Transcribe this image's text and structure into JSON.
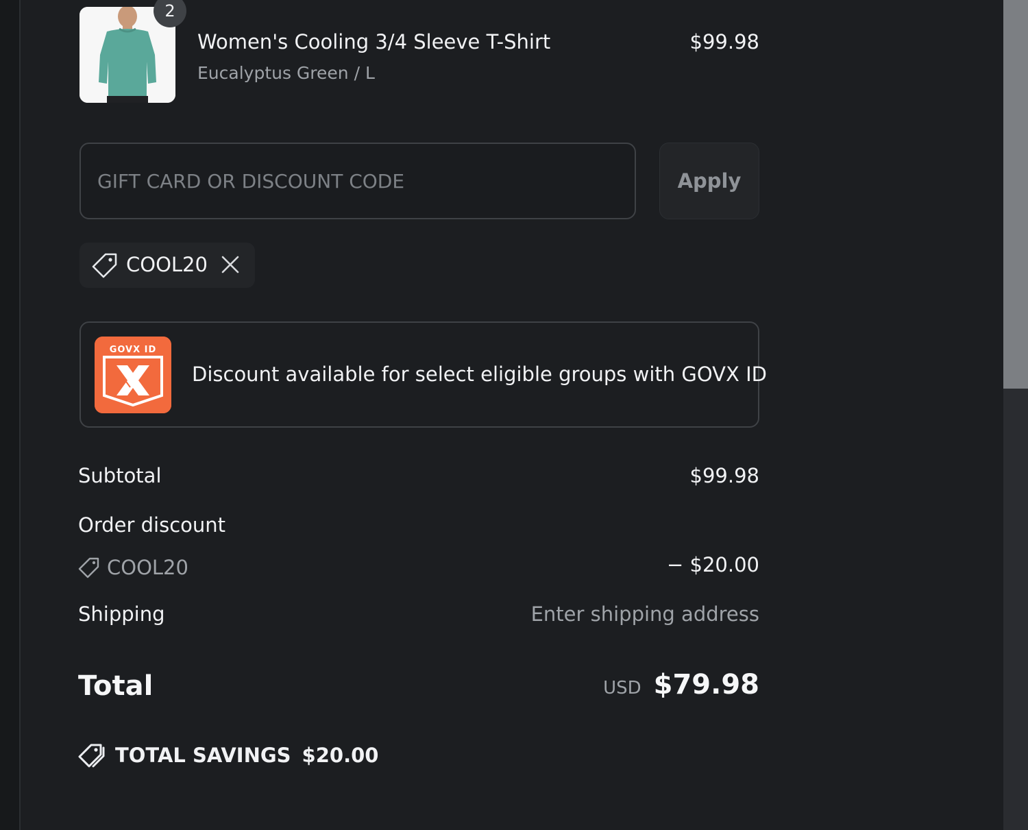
{
  "product": {
    "title": "Women's Cooling 3/4 Sleeve T-Shirt",
    "variant": "Eucalyptus Green / L",
    "price": "$99.98",
    "quantity": "2",
    "image_icon": "shirt-thumbnail"
  },
  "discount_form": {
    "placeholder": "GIFT CARD OR DISCOUNT CODE",
    "value": "",
    "apply_label": "Apply"
  },
  "applied_code": {
    "code": "COOL20",
    "tag_icon": "tag-icon",
    "remove_icon": "close-icon"
  },
  "govx_banner": {
    "logo_text": "GOVX ID",
    "text": "Discount available for select eligible groups with GOVX ID",
    "logo_color": "#f26a3d"
  },
  "summary": {
    "subtotal_label": "Subtotal",
    "subtotal_value": "$99.98",
    "order_discount_label": "Order discount",
    "discount_code": "COOL20",
    "discount_value": "− $20.00",
    "shipping_label": "Shipping",
    "shipping_value": "Enter shipping address",
    "total_label": "Total",
    "total_currency": "USD",
    "total_value": "$79.98",
    "savings_label": "TOTAL SAVINGS",
    "savings_value": "$20.00"
  },
  "colors": {
    "background": "#1c1e21",
    "text": "#f1f2f4",
    "muted_text": "#9fa3a8",
    "border": "#3f4246"
  }
}
